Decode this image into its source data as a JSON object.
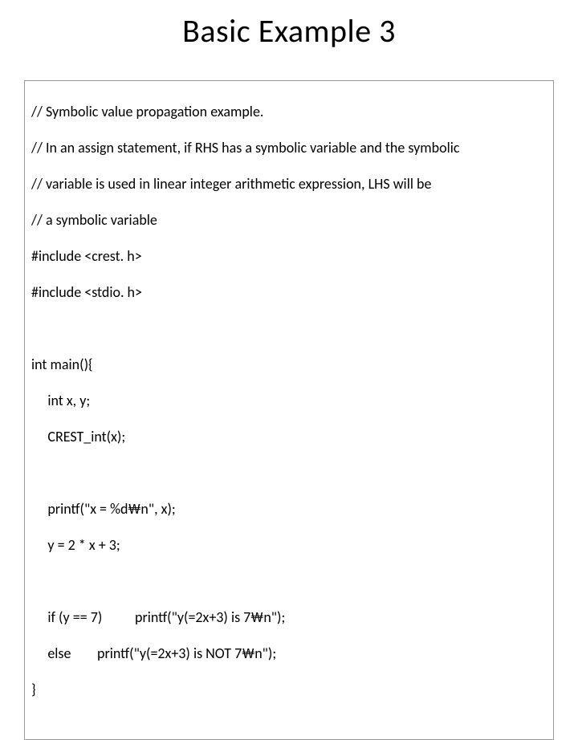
{
  "title": "Basic Example 3",
  "code": {
    "l0": "// Symbolic value propagation example.",
    "l1": "// In an assign statement, if RHS has a symbolic variable and the symbolic",
    "l2": "// variable is used in linear integer arithmetic expression, LHS will be",
    "l3": "// a symbolic variable",
    "l4": "#include <crest. h>",
    "l5": "#include <stdio. h>",
    "l6": " ",
    "l7": "int main(){",
    "l8": "     int x, y;",
    "l9": "     CREST_int(x);",
    "l10": " ",
    "l11": "     printf(\"x = %d₩n\", x);",
    "l12": "     y = 2 * x + 3;",
    "l13": " ",
    "l14": "     if (y == 7)          printf(\"y(=2x+3) is 7₩n\");",
    "l15": "     else        printf(\"y(=2x+3) is NOT 7₩n\");",
    "l16": "}"
  }
}
